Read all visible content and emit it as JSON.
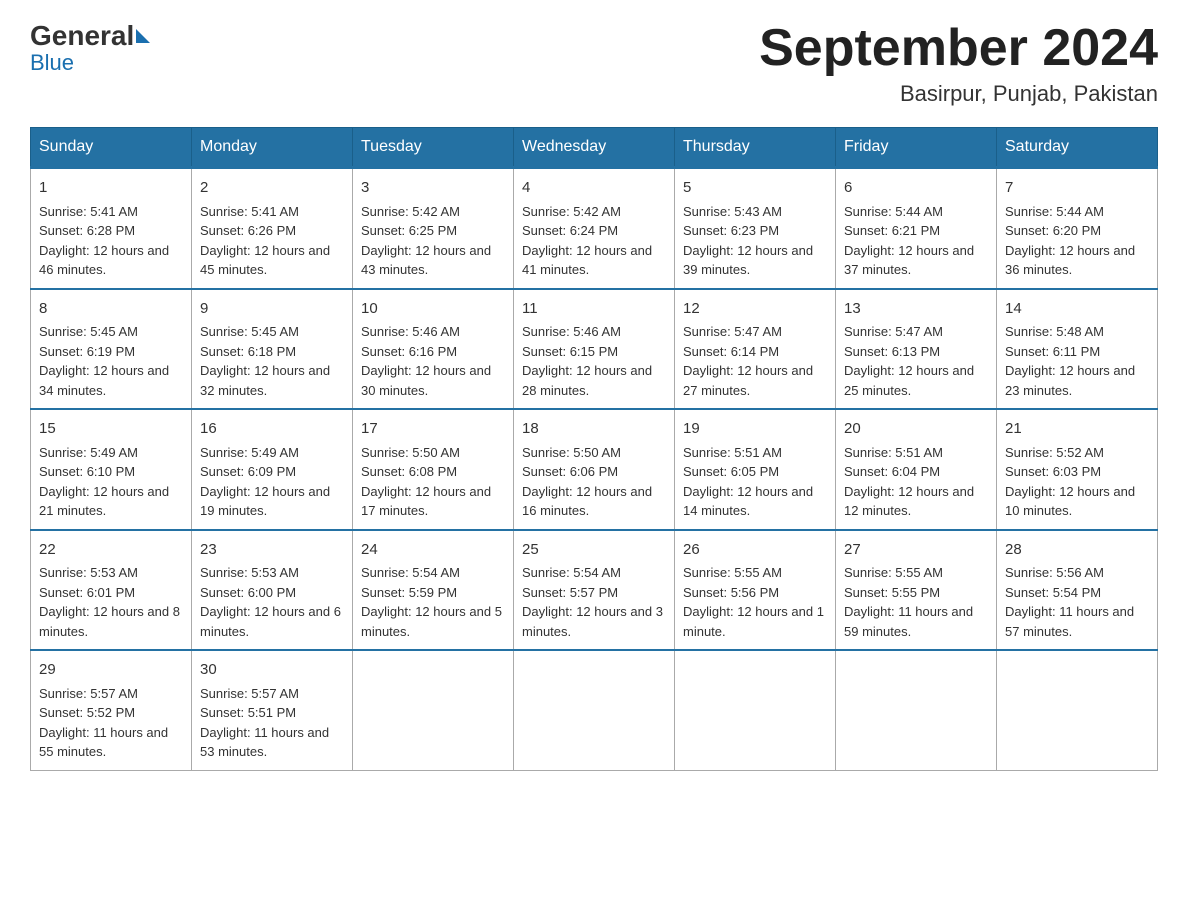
{
  "header": {
    "logo_general": "General",
    "logo_blue": "Blue",
    "month_title": "September 2024",
    "location": "Basirpur, Punjab, Pakistan"
  },
  "days_of_week": [
    "Sunday",
    "Monday",
    "Tuesday",
    "Wednesday",
    "Thursday",
    "Friday",
    "Saturday"
  ],
  "weeks": [
    [
      {
        "day": "1",
        "sunrise": "5:41 AM",
        "sunset": "6:28 PM",
        "daylight": "12 hours and 46 minutes."
      },
      {
        "day": "2",
        "sunrise": "5:41 AM",
        "sunset": "6:26 PM",
        "daylight": "12 hours and 45 minutes."
      },
      {
        "day": "3",
        "sunrise": "5:42 AM",
        "sunset": "6:25 PM",
        "daylight": "12 hours and 43 minutes."
      },
      {
        "day": "4",
        "sunrise": "5:42 AM",
        "sunset": "6:24 PM",
        "daylight": "12 hours and 41 minutes."
      },
      {
        "day": "5",
        "sunrise": "5:43 AM",
        "sunset": "6:23 PM",
        "daylight": "12 hours and 39 minutes."
      },
      {
        "day": "6",
        "sunrise": "5:44 AM",
        "sunset": "6:21 PM",
        "daylight": "12 hours and 37 minutes."
      },
      {
        "day": "7",
        "sunrise": "5:44 AM",
        "sunset": "6:20 PM",
        "daylight": "12 hours and 36 minutes."
      }
    ],
    [
      {
        "day": "8",
        "sunrise": "5:45 AM",
        "sunset": "6:19 PM",
        "daylight": "12 hours and 34 minutes."
      },
      {
        "day": "9",
        "sunrise": "5:45 AM",
        "sunset": "6:18 PM",
        "daylight": "12 hours and 32 minutes."
      },
      {
        "day": "10",
        "sunrise": "5:46 AM",
        "sunset": "6:16 PM",
        "daylight": "12 hours and 30 minutes."
      },
      {
        "day": "11",
        "sunrise": "5:46 AM",
        "sunset": "6:15 PM",
        "daylight": "12 hours and 28 minutes."
      },
      {
        "day": "12",
        "sunrise": "5:47 AM",
        "sunset": "6:14 PM",
        "daylight": "12 hours and 27 minutes."
      },
      {
        "day": "13",
        "sunrise": "5:47 AM",
        "sunset": "6:13 PM",
        "daylight": "12 hours and 25 minutes."
      },
      {
        "day": "14",
        "sunrise": "5:48 AM",
        "sunset": "6:11 PM",
        "daylight": "12 hours and 23 minutes."
      }
    ],
    [
      {
        "day": "15",
        "sunrise": "5:49 AM",
        "sunset": "6:10 PM",
        "daylight": "12 hours and 21 minutes."
      },
      {
        "day": "16",
        "sunrise": "5:49 AM",
        "sunset": "6:09 PM",
        "daylight": "12 hours and 19 minutes."
      },
      {
        "day": "17",
        "sunrise": "5:50 AM",
        "sunset": "6:08 PM",
        "daylight": "12 hours and 17 minutes."
      },
      {
        "day": "18",
        "sunrise": "5:50 AM",
        "sunset": "6:06 PM",
        "daylight": "12 hours and 16 minutes."
      },
      {
        "day": "19",
        "sunrise": "5:51 AM",
        "sunset": "6:05 PM",
        "daylight": "12 hours and 14 minutes."
      },
      {
        "day": "20",
        "sunrise": "5:51 AM",
        "sunset": "6:04 PM",
        "daylight": "12 hours and 12 minutes."
      },
      {
        "day": "21",
        "sunrise": "5:52 AM",
        "sunset": "6:03 PM",
        "daylight": "12 hours and 10 minutes."
      }
    ],
    [
      {
        "day": "22",
        "sunrise": "5:53 AM",
        "sunset": "6:01 PM",
        "daylight": "12 hours and 8 minutes."
      },
      {
        "day": "23",
        "sunrise": "5:53 AM",
        "sunset": "6:00 PM",
        "daylight": "12 hours and 6 minutes."
      },
      {
        "day": "24",
        "sunrise": "5:54 AM",
        "sunset": "5:59 PM",
        "daylight": "12 hours and 5 minutes."
      },
      {
        "day": "25",
        "sunrise": "5:54 AM",
        "sunset": "5:57 PM",
        "daylight": "12 hours and 3 minutes."
      },
      {
        "day": "26",
        "sunrise": "5:55 AM",
        "sunset": "5:56 PM",
        "daylight": "12 hours and 1 minute."
      },
      {
        "day": "27",
        "sunrise": "5:55 AM",
        "sunset": "5:55 PM",
        "daylight": "11 hours and 59 minutes."
      },
      {
        "day": "28",
        "sunrise": "5:56 AM",
        "sunset": "5:54 PM",
        "daylight": "11 hours and 57 minutes."
      }
    ],
    [
      {
        "day": "29",
        "sunrise": "5:57 AM",
        "sunset": "5:52 PM",
        "daylight": "11 hours and 55 minutes."
      },
      {
        "day": "30",
        "sunrise": "5:57 AM",
        "sunset": "5:51 PM",
        "daylight": "11 hours and 53 minutes."
      },
      null,
      null,
      null,
      null,
      null
    ]
  ]
}
